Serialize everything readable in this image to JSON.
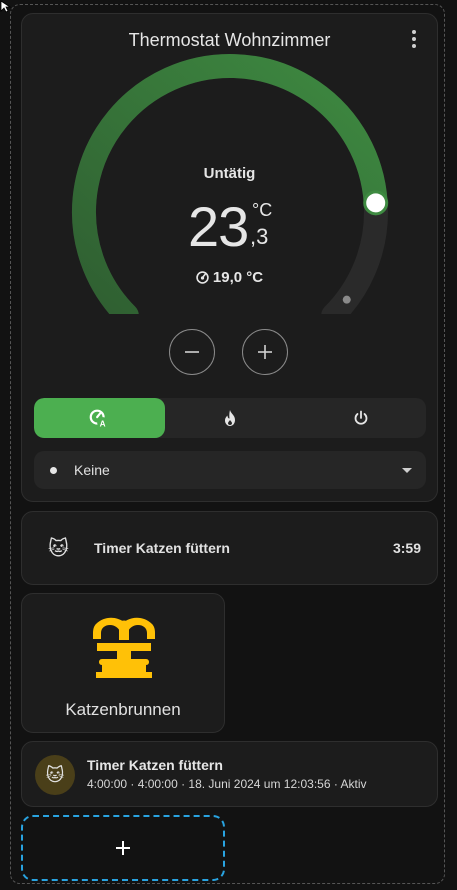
{
  "thermostat": {
    "title": "Thermostat Wohnzimmer",
    "hvac_action": "Untätig",
    "target_integer": "23",
    "target_decimal": ",3",
    "target_unit": "°C",
    "current_temperature": "19,0 °C",
    "target_value": 23.3,
    "current_value": 19.0,
    "gauge_fill_fraction": 0.82,
    "current_marker_fraction": 0.97,
    "active_color": "#4caf50",
    "modes": [
      {
        "name": "auto",
        "icon": "thermostat-auto-icon",
        "active": true
      },
      {
        "name": "heat",
        "icon": "fire-icon",
        "active": false
      },
      {
        "name": "off",
        "icon": "power-icon",
        "active": false
      }
    ],
    "preset_label": "Keine",
    "menu_icon": "dots-vertical-icon",
    "minus_icon": "minus-icon",
    "plus_icon": "plus-icon"
  },
  "timer_tile": {
    "icon": "🐱",
    "name": "Timer Katzen füttern",
    "state": "3:59"
  },
  "fountain_button": {
    "icon": "fountain-icon",
    "icon_color": "#ffc107",
    "name": "Katzenbrunnen"
  },
  "timer_entity": {
    "icon": "🐱",
    "name": "Timer Katzen füttern",
    "details": "4:00:00 · 4:00:00 · 18. Juni 2024 um 12:03:56 · Aktiv"
  },
  "add_card": {
    "icon": "plus-icon",
    "accent": "#29a3e0"
  }
}
